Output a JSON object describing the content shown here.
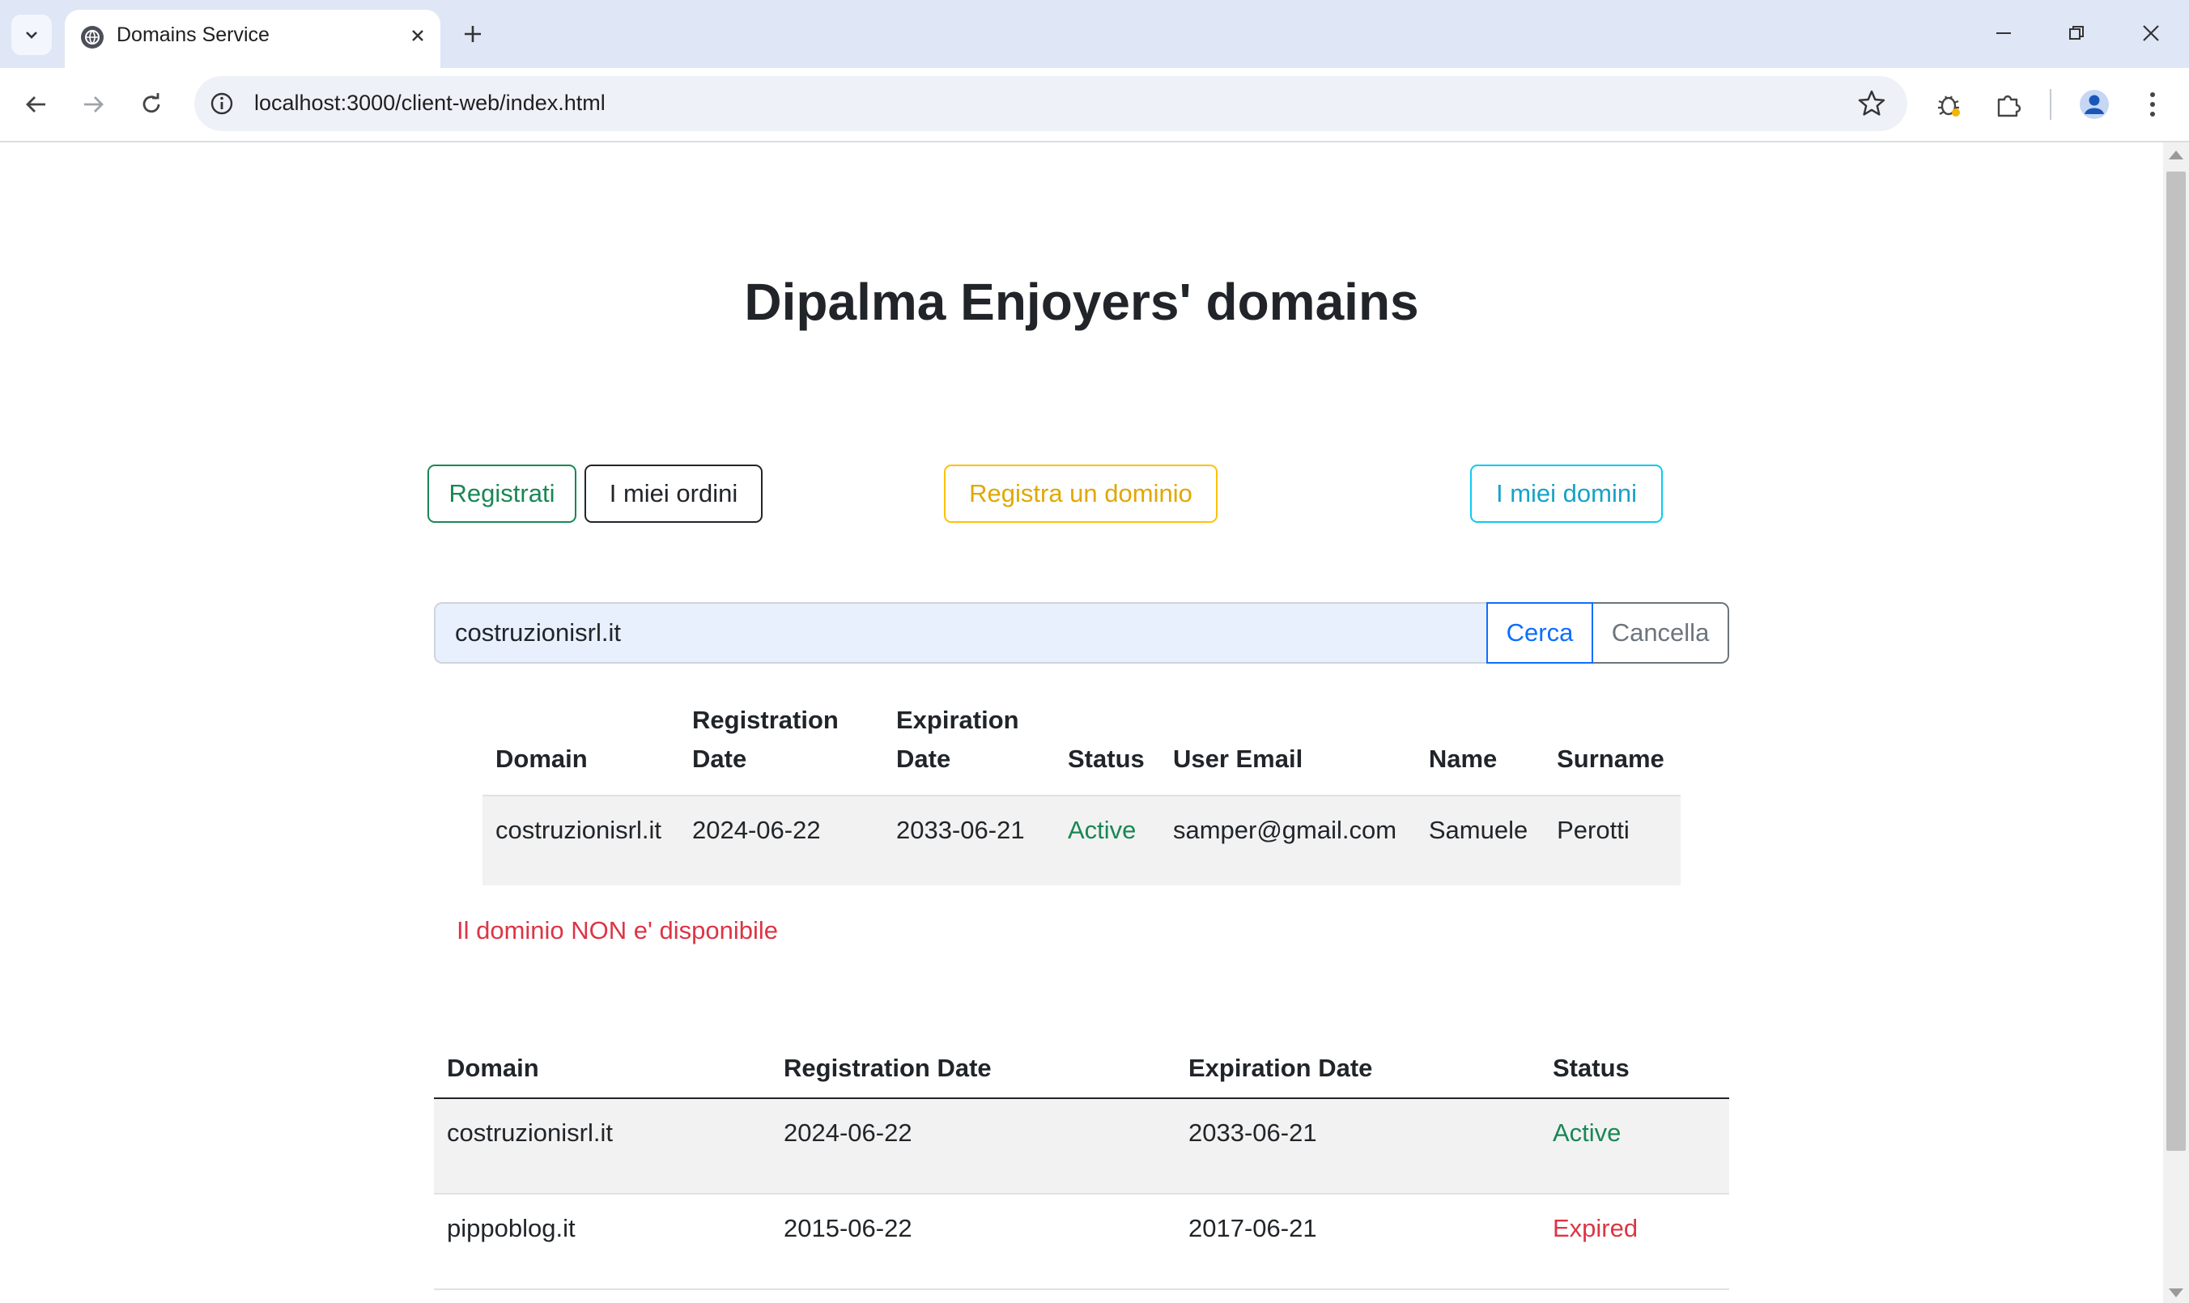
{
  "browser": {
    "tab_title": "Domains Service",
    "url": "localhost:3000/client-web/index.html"
  },
  "page": {
    "title": "Dipalma Enjoyers' domains",
    "buttons": {
      "register": "Registrati",
      "my_orders": "I miei ordini",
      "register_domain": "Registra un dominio",
      "my_domains": "I miei domini"
    },
    "search": {
      "value": "costruzionisrl.it",
      "search_label": "Cerca",
      "cancel_label": "Cancella"
    },
    "search_result": {
      "headers": {
        "domain": "Domain",
        "registration_date": "Registration Date",
        "expiration_date": "Expiration Date",
        "status": "Status",
        "user_email": "User Email",
        "name": "Name",
        "surname": "Surname"
      },
      "row": {
        "domain": "costruzionisrl.it",
        "registration_date": "2024-06-22",
        "expiration_date": "2033-06-21",
        "status": "Active",
        "user_email": "samper@gmail.com",
        "name": "Samuele",
        "surname": "Perotti"
      },
      "message": "Il dominio NON e' disponibile"
    },
    "my_domains": {
      "headers": {
        "domain": "Domain",
        "registration_date": "Registration Date",
        "expiration_date": "Expiration Date",
        "status": "Status"
      },
      "rows": [
        {
          "domain": "costruzionisrl.it",
          "registration_date": "2024-06-22",
          "expiration_date": "2033-06-21",
          "status": "Active"
        },
        {
          "domain": "pippoblog.it",
          "registration_date": "2015-06-22",
          "expiration_date": "2017-06-21",
          "status": "Expired"
        }
      ]
    }
  },
  "colors": {
    "active": "#198754",
    "expired": "#dc3545",
    "error": "#dc3545"
  }
}
